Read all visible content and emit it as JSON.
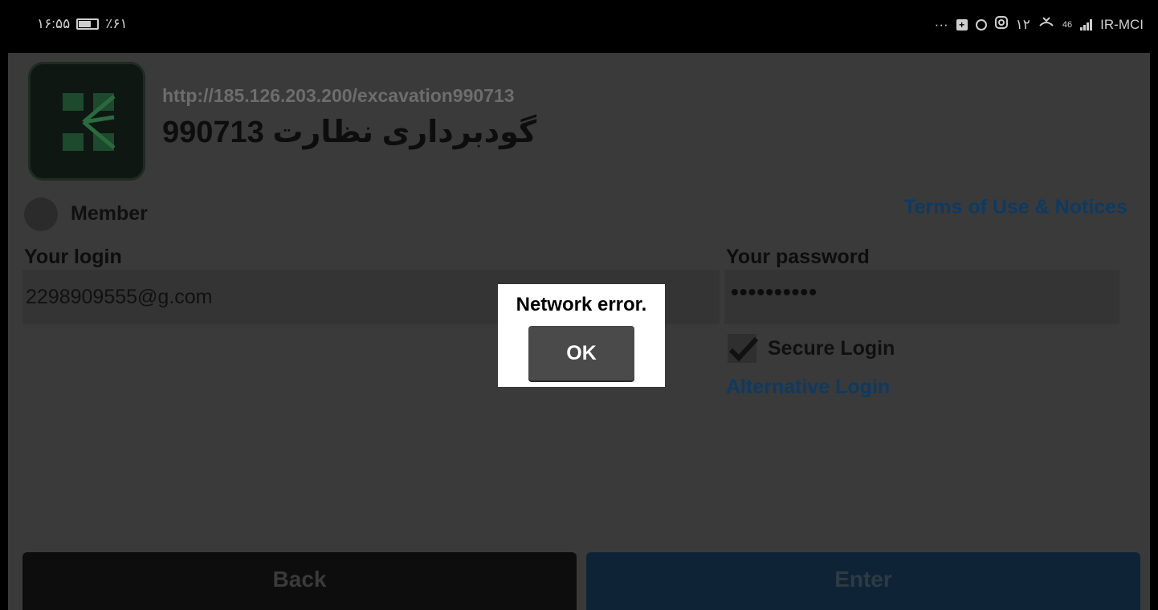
{
  "status_bar": {
    "time": "۱۶:۵۵",
    "battery_percent": "٪۶۱",
    "battery_level": 0.61,
    "notifications_more": "···",
    "clock_small": "۱۲",
    "network_type": "46",
    "carrier": "IR-MCI",
    "icons": [
      "add-box-icon",
      "circle-icon",
      "instagram-icon",
      "missed-call-icon",
      "signal-icon"
    ]
  },
  "app": {
    "url": "http://185.126.203.200/excavation990713",
    "title": "گودبرداری نظارت 990713",
    "member_label": "Member",
    "terms_link": "Terms of Use & Notices",
    "login_label": "Your login",
    "login_value": "2298909555@g.com",
    "password_label": "Your password",
    "password_value": "••••••••••",
    "secure_login_label": "Secure Login",
    "secure_login_checked": true,
    "alternative_login": "Alternative Login",
    "back_button": "Back",
    "enter_button": "Enter"
  },
  "dialog": {
    "message": "Network error.",
    "ok_button": "OK"
  },
  "colors": {
    "overlay_background": "#3a3a3a",
    "link": "#0d3a62",
    "dialog_background": "#ffffff",
    "ok_button": "#4a4a4a"
  }
}
